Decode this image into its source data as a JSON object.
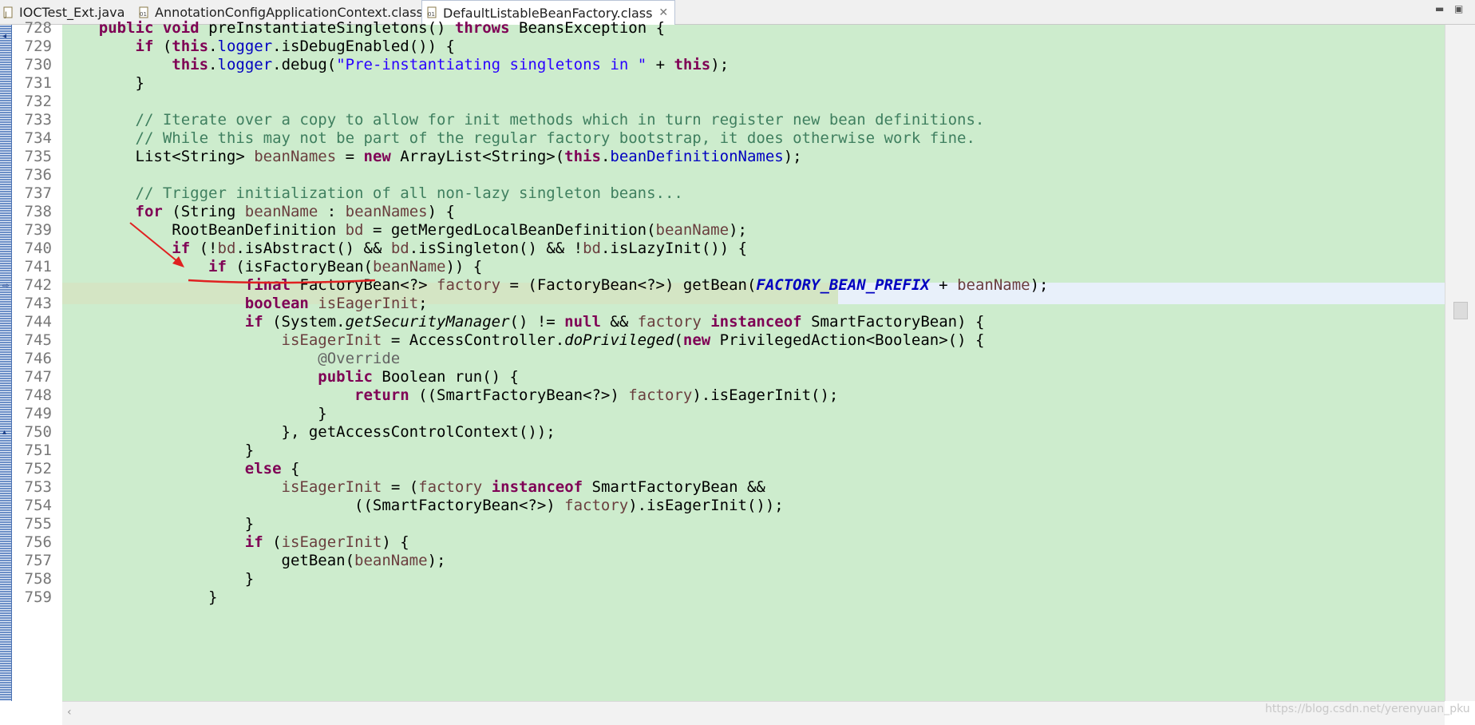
{
  "tabs": [
    {
      "label": "IOCTest_Ext.java"
    },
    {
      "label": "AnnotationConfigApplicationContext.class"
    },
    {
      "label": "DefaultListableBeanFactory.class",
      "active": true
    }
  ],
  "window_controls": {
    "minimize": "▭",
    "maximize": "▭"
  },
  "editor": {
    "highlighted_line": 740,
    "lines": [
      {
        "n": "728"
      },
      {
        "n": "729"
      },
      {
        "n": "730"
      },
      {
        "n": "731"
      },
      {
        "n": "732"
      },
      {
        "n": "733"
      },
      {
        "n": "734"
      },
      {
        "n": "735"
      },
      {
        "n": "736"
      },
      {
        "n": "737"
      },
      {
        "n": "738"
      },
      {
        "n": "739"
      },
      {
        "n": "740"
      },
      {
        "n": "741"
      },
      {
        "n": "742"
      },
      {
        "n": "743"
      },
      {
        "n": "744"
      },
      {
        "n": "745"
      },
      {
        "n": "746"
      },
      {
        "n": "747"
      },
      {
        "n": "748"
      },
      {
        "n": "749"
      },
      {
        "n": "750"
      },
      {
        "n": "751"
      },
      {
        "n": "752"
      },
      {
        "n": "753"
      },
      {
        "n": "754"
      },
      {
        "n": "755"
      },
      {
        "n": "756"
      },
      {
        "n": "757"
      },
      {
        "n": "758"
      },
      {
        "n": "759"
      }
    ],
    "tokens": {
      "l728": [
        "    ",
        "public",
        " ",
        "void",
        " preInstantiateSingletons() ",
        "throws",
        " BeansException {"
      ],
      "l729": [
        "        ",
        "if",
        " (",
        "this",
        ".",
        "logger",
        ".isDebugEnabled()) {"
      ],
      "l730": [
        "            ",
        "this",
        ".",
        "logger",
        ".debug(",
        "\"Pre-instantiating singletons in \"",
        " + ",
        "this",
        ");"
      ],
      "l731": [
        "        }"
      ],
      "l733": [
        "        // Iterate over a copy to allow for init methods which in turn register new bean definitions."
      ],
      "l734": [
        "        // While this may not be part of the regular factory bootstrap, it does otherwise work fine."
      ],
      "l735": [
        "        List<String> ",
        "beanNames",
        " = ",
        "new",
        " ArrayList<String>(",
        "this",
        ".",
        "beanDefinitionNames",
        ");"
      ],
      "l737": [
        "        // Trigger initialization of all non-lazy singleton beans..."
      ],
      "l738": [
        "        ",
        "for",
        " (String ",
        "beanName",
        " : ",
        "beanNames",
        ") {"
      ],
      "l739": [
        "            RootBeanDefinition ",
        "bd",
        " = getMergedLocalBeanDefinition(",
        "beanName",
        ");"
      ],
      "l740": [
        "            ",
        "if",
        " (!",
        "bd",
        ".isAbstract() && ",
        "bd",
        ".isSingleton() && !",
        "bd",
        ".isLazyInit()) {"
      ],
      "l741": [
        "                ",
        "if",
        " (isFactoryBean(",
        "beanName",
        ")) {"
      ],
      "l742": [
        "                    ",
        "final",
        " FactoryBean<?> ",
        "factory",
        " = (FactoryBean<?>) getBean(",
        "FACTORY_BEAN_PREFIX",
        " + ",
        "beanName",
        ");"
      ],
      "l743": [
        "                    ",
        "boolean",
        " ",
        "isEagerInit",
        ";"
      ],
      "l744": [
        "                    ",
        "if",
        " (System.",
        "getSecurityManager",
        "() != ",
        "null",
        " && ",
        "factory",
        " ",
        "instanceof",
        " SmartFactoryBean) {"
      ],
      "l745": [
        "                        ",
        "isEagerInit",
        " = AccessController.",
        "doPrivileged",
        "(",
        "new",
        " PrivilegedAction<Boolean>() {"
      ],
      "l746": [
        "                            ",
        "@Override"
      ],
      "l747": [
        "                            ",
        "public",
        " Boolean run() {"
      ],
      "l748": [
        "                                ",
        "return",
        " ((SmartFactoryBean<?>) ",
        "factory",
        ").isEagerInit();"
      ],
      "l749": [
        "                            }"
      ],
      "l750": [
        "                        }, getAccessControlContext());"
      ],
      "l751": [
        "                    }"
      ],
      "l752": [
        "                    ",
        "else",
        " {"
      ],
      "l753": [
        "                        ",
        "isEagerInit",
        " = (",
        "factory",
        " ",
        "instanceof",
        " SmartFactoryBean &&"
      ],
      "l754": [
        "                                ((SmartFactoryBean<?>) ",
        "factory",
        ").isEagerInit());"
      ],
      "l755": [
        "                    }"
      ],
      "l756": [
        "                    ",
        "if",
        " (",
        "isEagerInit",
        ") {"
      ],
      "l757": [
        "                        getBean(",
        "beanName",
        ");"
      ],
      "l758": [
        "                    }"
      ],
      "l759": [
        "                }"
      ]
    }
  },
  "watermark": "https://blog.csdn.net/yerenyuan_pku",
  "colors": {
    "code_bg": "#cdeccd",
    "current_line": "#d4e5c4",
    "keyword": "#7f0055",
    "field": "#0000c0",
    "local_var": "#6a3e3e",
    "string": "#2a00ff",
    "comment": "#3f7f5f",
    "annotation_arrow": "#e02020"
  }
}
